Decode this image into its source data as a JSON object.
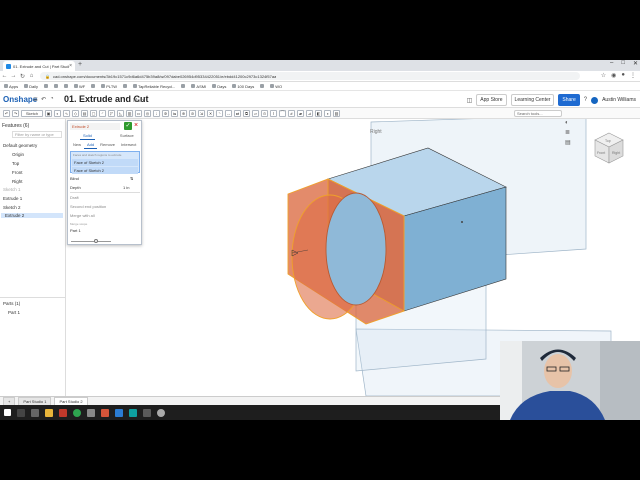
{
  "browser": {
    "tab_title": "01. Extrude and Cut | Part Studio 1",
    "url": "cad.onshape.com/documents/3b19c1571c9d6a6d475b39a8/w/097dabe026954d95334422051/e/ebdd41200c2973c1324f57aa",
    "bookmarks": [
      "Apps",
      "Daily",
      "",
      "",
      "",
      "WF",
      "",
      "PLTW",
      "",
      "TapReliable Recycl...",
      "",
      "ASMI",
      "Days",
      "100 Days",
      "",
      "WO"
    ]
  },
  "onshape": {
    "logo": "Onshape",
    "doc_title": "01. Extrude and Cut",
    "branch": "Main",
    "app_store": "App Store",
    "learning_center": "Learning Center",
    "share": "Share",
    "user_name": "Austin Williams",
    "sketch_label": "Sketch",
    "search_tools": "Search tools..."
  },
  "features": {
    "header": "Features (6)",
    "filter_placeholder": "Filter by name or type",
    "default_geometry": "Default geometry",
    "origin": "Origin",
    "top": "Top",
    "front": "Front",
    "right": "Right",
    "sketch1_dim": "Sketch 1",
    "extrude1": "Extrude 1",
    "sketch2": "Sketch 2",
    "extrude2": "Extrude 2",
    "parts_header": "Parts (1)",
    "part1": "Part 1"
  },
  "dialog": {
    "title": "Extrude 2",
    "solid": "Solid",
    "surface": "Surface",
    "new": "New",
    "add": "Add",
    "remove": "Remove",
    "intersect": "Intersect",
    "sel_hint": "Faces and sketch regions to extrude",
    "face1": "Face of Sketch 2",
    "face2": "Face of Sketch 2",
    "end_type": "Blind",
    "depth_label": "Depth",
    "depth_value": "1 in",
    "draft": "Draft",
    "second_end": "Second end position",
    "merge_all": "Merge with all",
    "merge_scope_label": "Merge scope",
    "merge_scope_value": "Part 1"
  },
  "graphics": {
    "plane_label": "Right",
    "viewcube_front": "Front",
    "viewcube_right": "Right",
    "viewcube_top": "Top"
  },
  "bottom_tabs": [
    "Part Studio 1",
    "Part Studio 2"
  ],
  "colors": {
    "brand": "#1a5fb4",
    "body_blue": "#8fbbd9",
    "preview_orange": "#d9643a",
    "selection": "#d3e5fb"
  }
}
